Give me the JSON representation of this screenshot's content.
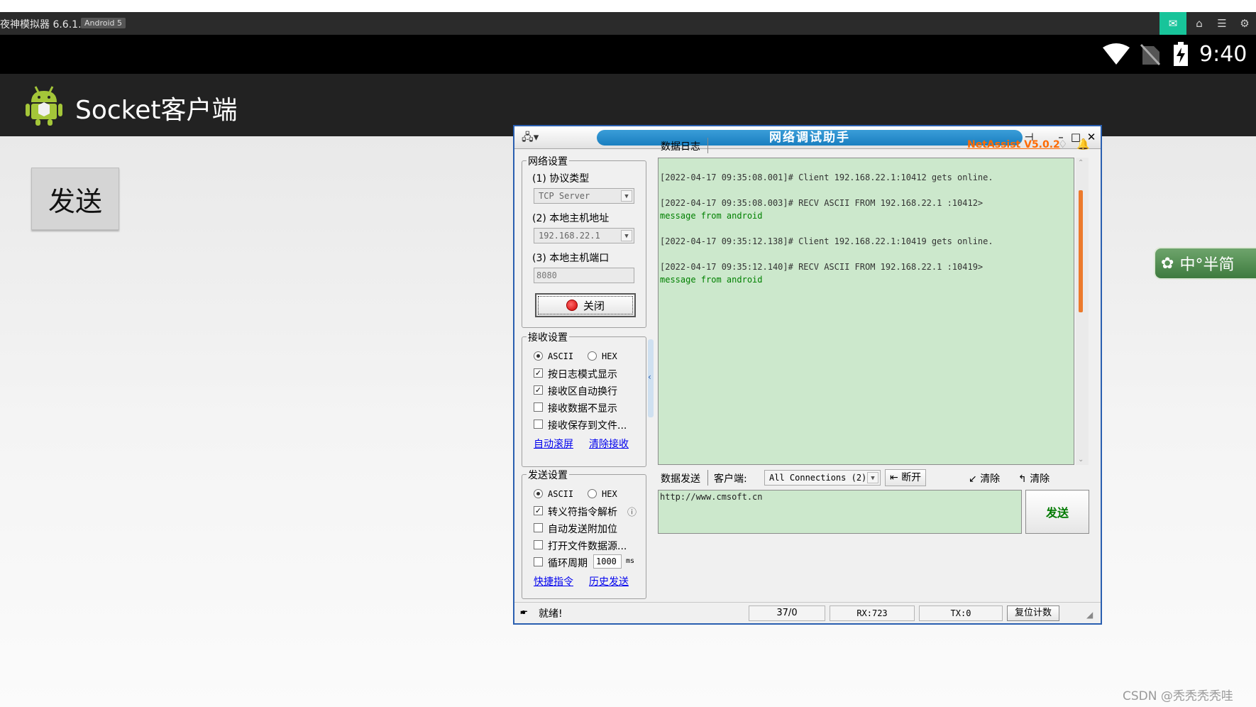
{
  "emulator": {
    "title": "夜神模拟器 6.6.1.1",
    "android_badge": "Android 5",
    "controls": [
      "mail-icon",
      "home-icon",
      "menu-icon",
      "gear-icon"
    ]
  },
  "status_bar": {
    "time": "9:40"
  },
  "app": {
    "title": "Socket客户端",
    "send_button": "发送"
  },
  "ime": {
    "label": "中°半简"
  },
  "watermark": "CSDN @秃秃秃秃哇",
  "netassist": {
    "title": "网络调试助手",
    "version": "NetAssist V5.0.2",
    "network_settings": {
      "title": "网络设置",
      "protocol_label": "(1) 协议类型",
      "protocol_value": "TCP Server",
      "host_label": "(2) 本地主机地址",
      "host_value": "192.168.22.1",
      "port_label": "(3) 本地主机端口",
      "port_value": "8080",
      "close_button": "关闭"
    },
    "receive_settings": {
      "title": "接收设置",
      "ascii": "ASCII",
      "hex": "HEX",
      "options": [
        "按日志模式显示",
        "接收区自动换行",
        "接收数据不显示",
        "接收保存到文件..."
      ],
      "checked": [
        true,
        true,
        false,
        false
      ],
      "link_autoscroll": "自动滚屏",
      "link_clear": "清除接收"
    },
    "send_settings": {
      "title": "发送设置",
      "ascii": "ASCII",
      "hex": "HEX",
      "options": [
        "转义符指令解析",
        "自动发送附加位",
        "打开文件数据源...",
        "循环周期"
      ],
      "checked": [
        true,
        false,
        false,
        false
      ],
      "cycle_value": "1000",
      "cycle_unit": "ms",
      "link_shortcut": "快捷指令",
      "link_history": "历史发送"
    },
    "log_tab": "数据日志",
    "log": [
      "[2022-04-17 09:35:08.001]# Client 192.168.22.1:10412 gets online.",
      "[2022-04-17 09:35:08.003]# RECV ASCII FROM 192.168.22.1 :10412>",
      "message from android",
      "[2022-04-17 09:35:12.138]# Client 192.168.22.1:10419 gets online.",
      "[2022-04-17 09:35:12.140]# RECV ASCII FROM 192.168.22.1 :10419>",
      "message from android"
    ],
    "send_tab": "数据发送",
    "client_label": "客户端:",
    "client_select": "All Connections (2)",
    "disconnect": "断开",
    "clear1": "清除",
    "clear2": "清除",
    "send_text": "http://www.cmsoft.cn",
    "send_button": "发送",
    "status": {
      "ready": "就绪!",
      "count": "37/0",
      "rx": "RX:723",
      "tx": "TX:0",
      "reset": "复位计数"
    }
  }
}
